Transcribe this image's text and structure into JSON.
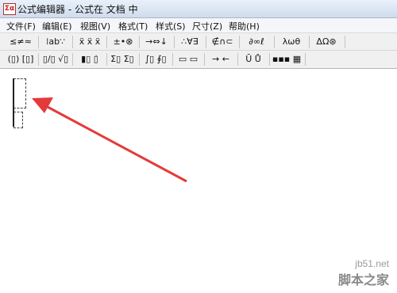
{
  "window": {
    "icon_text": "Σα",
    "title": "公式编辑器 - 公式在 文档 中"
  },
  "menu": [
    "文件(F)",
    "编辑(E)",
    "视图(V)",
    "格式(T)",
    "样式(S)",
    "尺寸(Z)",
    "帮助(H)"
  ],
  "toolbar_row1": [
    {
      "name": "relations-palette-button",
      "label": "≤≠≈"
    },
    {
      "name": "spaces-ellipses-palette-button",
      "label": "⁞ab∵"
    },
    {
      "name": "embellishments-palette-button",
      "label": "ẍ ẍ ẍ"
    },
    {
      "name": "operators-palette-button",
      "label": "±•⊗"
    },
    {
      "name": "arrows-palette-button",
      "label": "→⇔↓"
    },
    {
      "name": "logic-palette-button",
      "label": "∴∀∃"
    },
    {
      "name": "set-theory-palette-button",
      "label": "∉∩⊂"
    },
    {
      "name": "misc-symbols-palette-button",
      "label": "∂∞ℓ"
    },
    {
      "name": "greek-lowercase-palette-button",
      "label": "λωθ"
    },
    {
      "name": "greek-uppercase-palette-button",
      "label": "ΔΩ⊛"
    }
  ],
  "toolbar_row2": [
    {
      "name": "fence-templates-button",
      "label": "(▯) [▯]"
    },
    {
      "name": "fraction-radical-templates-button",
      "label": "▯/▯ √▯"
    },
    {
      "name": "subscript-superscript-templates-button",
      "label": "▮▯ ▯̇"
    },
    {
      "name": "summation-templates-button",
      "label": "Σ▯ Σ▯"
    },
    {
      "name": "integral-templates-button",
      "label": "∫▯ ∮▯"
    },
    {
      "name": "underbar-overbar-templates-button",
      "label": "▭ ▭"
    },
    {
      "name": "labeled-arrow-templates-button",
      "label": "→ ←"
    },
    {
      "name": "products-set-templates-button",
      "label": "Ū Ů"
    },
    {
      "name": "matrix-templates-button",
      "label": "▪▪▪ ▦"
    }
  ],
  "watermark": {
    "url": "jb51.net",
    "name": "脚本之家"
  },
  "colors": {
    "arrow": "#e53a3a"
  }
}
